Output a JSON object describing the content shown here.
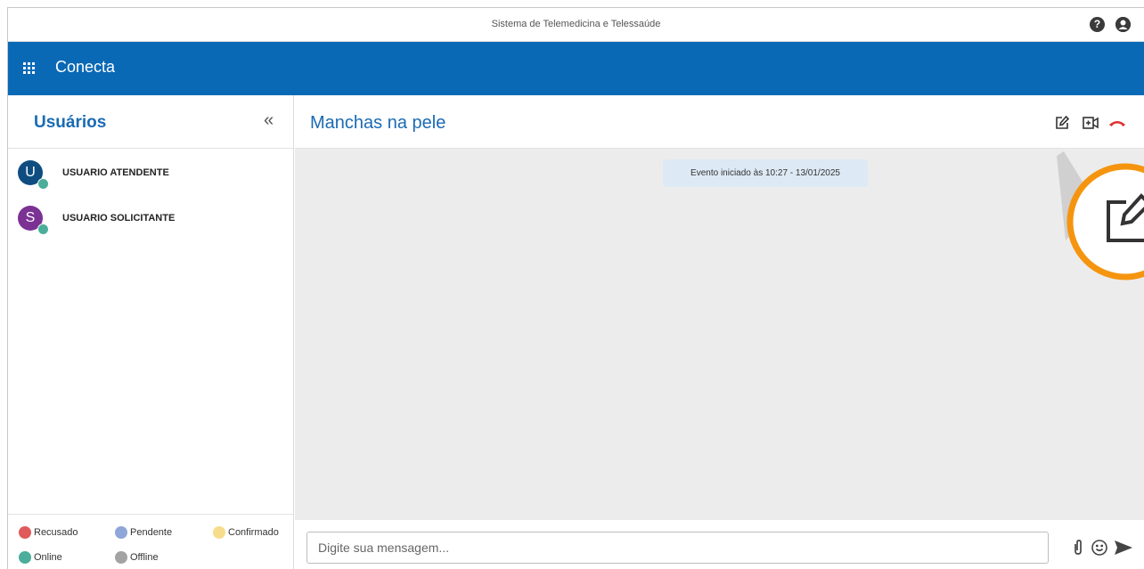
{
  "window": {
    "title": "Sistema de Telemedicina e Telessaúde"
  },
  "app": {
    "name": "Conecta"
  },
  "sidebar": {
    "title": "Usuários",
    "users": [
      {
        "initial": "U",
        "name": "USUARIO ATENDENTE",
        "avatar_color": "#0f4d80",
        "status_color": "#4aae9b"
      },
      {
        "initial": "S",
        "name": "USUARIO SOLICITANTE",
        "avatar_color": "#7b3294",
        "status_color": "#4aae9b"
      }
    ],
    "legend": [
      {
        "label": "Recusado",
        "color": "#e05a5a"
      },
      {
        "label": "Pendente",
        "color": "#8fa6d8"
      },
      {
        "label": "Confirmado",
        "color": "#f7dc8b"
      },
      {
        "label": "Online",
        "color": "#4aae9b"
      },
      {
        "label": "Offline",
        "color": "#a3a3a3"
      }
    ]
  },
  "chat": {
    "title": "Manchas na pele",
    "event": "Evento iniciado às 10:27 - 13/01/2025",
    "input_placeholder": "Digite sua mensagem..."
  },
  "colors": {
    "primary": "#0a69b5",
    "title_blue": "#1a6bb3",
    "hangup": "#e03131",
    "callout": "#f5950f",
    "chat_bg": "#ececec"
  },
  "icons": [
    "help-icon",
    "user-circle-icon",
    "apps-icon",
    "collapse-icon",
    "edit-icon",
    "video-add-icon",
    "hangup-icon",
    "attach-icon",
    "emoji-icon",
    "send-icon"
  ]
}
